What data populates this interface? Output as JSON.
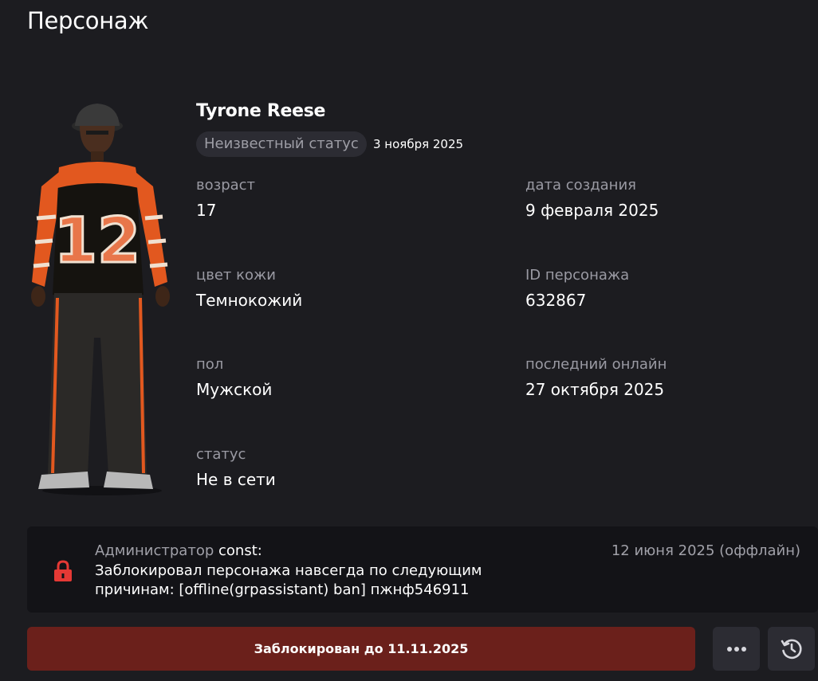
{
  "page": {
    "title": "Персонаж"
  },
  "character": {
    "name": "Tyrone Reese",
    "status_badge": "Неизвестный статус",
    "status_date": "3 ноября 2025"
  },
  "fields": {
    "age": {
      "label": "возраст",
      "value": "17"
    },
    "created": {
      "label": "дата создания",
      "value": "9 февраля 2025"
    },
    "skin": {
      "label": "цвет кожи",
      "value": "Темнокожий"
    },
    "char_id": {
      "label": "ID персонажа",
      "value": "632867"
    },
    "gender": {
      "label": "пол",
      "value": "Мужской"
    },
    "last_online": {
      "label": "последний онлайн",
      "value": "27 октября 2025"
    },
    "status": {
      "label": "статус",
      "value": "Не в сети"
    }
  },
  "ban_log": {
    "role": "Администратор",
    "admin": "const:",
    "text": "Заблокировал персонажа навсегда по следующим причинам: [offline(grpassistant) ban] пжнф546911",
    "date": "12 июня 2025 (оффлайн)",
    "icon": "lock-icon",
    "icon_color": "#e53935"
  },
  "actions": {
    "ban_label": "Заблокирован до 11.11.2025",
    "more_icon": "more-dots-icon",
    "history_icon": "history-clock-icon"
  },
  "colors": {
    "background": "#1c1c20",
    "panel": "#131317",
    "badge": "#2c2c33",
    "ban_button": "#6b201b",
    "muted_text": "#9a9aa3"
  }
}
